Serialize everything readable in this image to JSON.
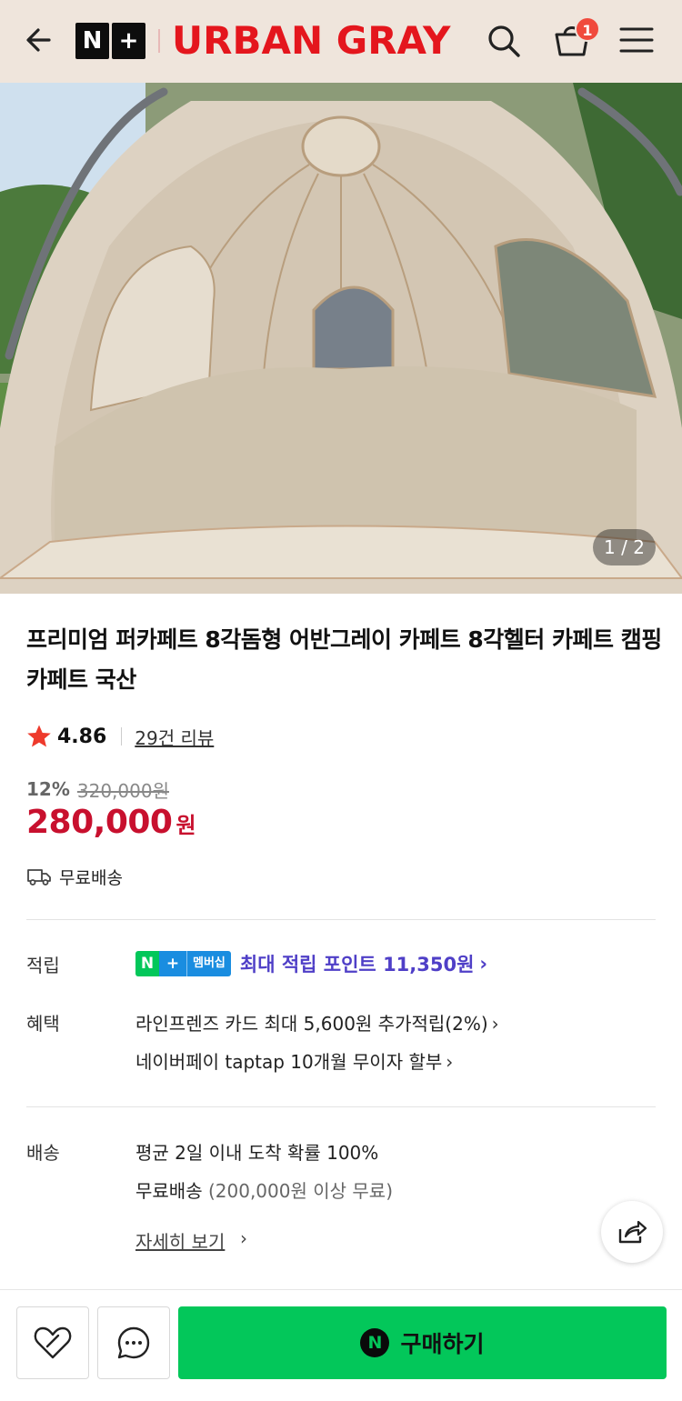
{
  "header": {
    "logo_left": "N",
    "logo_right": "+",
    "brand": "URBAN GRAY",
    "cart_count": "1"
  },
  "gallery": {
    "counter_current": "1",
    "counter_sep": " / ",
    "counter_total": "2"
  },
  "product": {
    "title": "프리미엄 퍼카페트 8각돔형 어반그레이 카페트 8각헬터 카페트 캠핑카페트 국산",
    "rating": "4.86",
    "reviews": "29건 리뷰",
    "discount_rate": "12%",
    "original_price": "320,000원",
    "sale_price": "280,000",
    "sale_unit": "원",
    "shipping_badge": "무료배송"
  },
  "info": {
    "points_label": "적립",
    "membership_n": "N",
    "membership_plus": "+",
    "membership_badge": "멤버십",
    "points_text": "최대 적립 포인트 11,350원",
    "benefits_label": "혜택",
    "benefit_1": "라인프렌즈 카드 최대 5,600원 추가적립(2%)",
    "benefit_2": "네이버페이 taptap 10개월 무이자 할부",
    "delivery_label": "배송",
    "delivery_1": "평균 2일 이내 도착 확률 100%",
    "delivery_2_main": "무료배송",
    "delivery_2_note": "(200,000원 이상 무료)",
    "detail_link": "자세히 보기",
    "chevron": "›"
  },
  "bottom": {
    "buy_icon": "N",
    "buy_label": "구매하기"
  },
  "icons": {
    "back": "back-arrow-icon",
    "search": "search-icon",
    "cart": "cart-icon",
    "menu": "menu-icon",
    "star": "star-icon",
    "truck": "truck-icon",
    "share": "share-icon",
    "wish": "heart-icon",
    "talk": "chat-icon"
  },
  "colors": {
    "header_bg": "#efe5dc",
    "brand": "#e4161d",
    "sale_price": "#c8102e",
    "points": "#4f3fc7",
    "buy_button": "#03c75a"
  }
}
